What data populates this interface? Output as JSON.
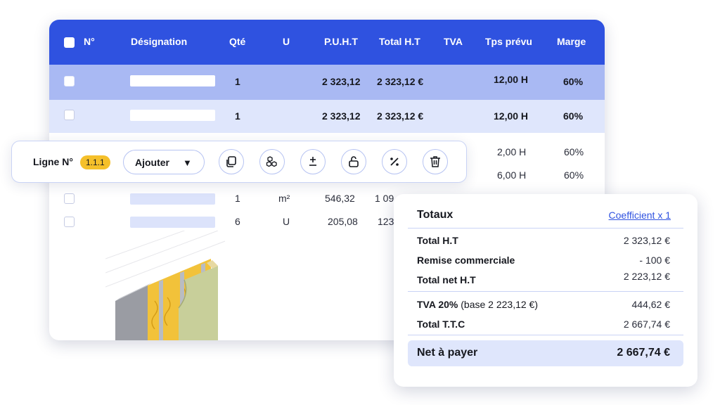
{
  "table": {
    "headers": {
      "num": "N°",
      "designation": "Désignation",
      "qty": "Qté",
      "unit": "U",
      "unit_price": "P.U.H.T",
      "total_ht": "Total H.T",
      "vat": "TVA",
      "planned_time": "Tps prévu",
      "margin": "Marge"
    },
    "rows": [
      {
        "qty": "1",
        "unit": "",
        "unit_price": "2 323,12",
        "total_ht": "2 323,12 €",
        "vat": "",
        "planned_time": "12,00 H",
        "margin": "60%"
      },
      {
        "qty": "1",
        "unit": "",
        "unit_price": "2 323,12",
        "total_ht": "2 323,12 €",
        "vat": "",
        "planned_time": "12,00 H",
        "margin": "60%"
      },
      {
        "qty": "",
        "unit": "",
        "unit_price": "",
        "total_ht": "",
        "vat": "",
        "planned_time": "2,00 H",
        "margin": "60%"
      },
      {
        "qty": "",
        "unit": "",
        "unit_price": "",
        "total_ht": "",
        "vat": "",
        "planned_time": "6,00 H",
        "margin": "60%"
      },
      {
        "qty": "1",
        "unit": "m²",
        "unit_price": "546,32",
        "total_ht": "1 09",
        "vat": "",
        "planned_time": "",
        "margin": ""
      },
      {
        "qty": "6",
        "unit": "U",
        "unit_price": "205,08",
        "total_ht": "123",
        "vat": "",
        "planned_time": "",
        "margin": ""
      }
    ]
  },
  "toolbar": {
    "line_label": "Ligne N°",
    "line_number": "1.1.1",
    "add_label": "Ajouter",
    "icons": [
      "copy-icon",
      "boxes-icon",
      "plus-minus-icon",
      "unlock-icon",
      "percent-icon",
      "trash-icon"
    ]
  },
  "totals": {
    "title": "Totaux",
    "coefficient_link": "Coefficient x 1",
    "total_ht_label": "Total H.T",
    "total_ht_value": "2 323,12 €",
    "discount_label": "Remise commerciale",
    "discount_value": "- 100 €",
    "net_ht_label": "Total net H.T",
    "net_ht_value": "2 223,12 €",
    "vat_label": "TVA 20%",
    "vat_base": "(base 2 223,12 €)",
    "vat_value": "444,62 €",
    "ttc_label": "Total T.T.C",
    "ttc_value": "2 667,74 €",
    "net_to_pay_label": "Net à payer",
    "net_to_pay_value": "2 667,74 €"
  },
  "colors": {
    "header_blue": "#2f52e0",
    "selected_row": "#a9b9f3",
    "light_row": "#dfe6fc",
    "badge_yellow": "#f5c02a"
  }
}
